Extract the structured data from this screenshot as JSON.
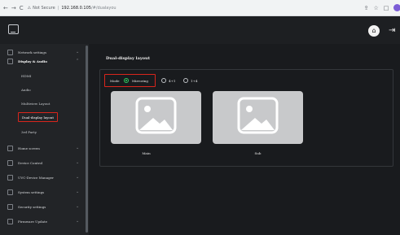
{
  "browser": {
    "back": "←",
    "forward": "→",
    "reload": "C",
    "security_label": "Not Secure",
    "url_host": "192.168.0.105",
    "url_path": "/#/dualayou",
    "share_icon": "⇪",
    "star_icon": "☆",
    "split_icon": "□"
  },
  "header": {
    "home_icon": "⌂",
    "exit_icon": "⇥"
  },
  "sidebar": {
    "items": [
      {
        "label": "Network settings",
        "chevron": "⌄",
        "icon": "wifi-icon"
      },
      {
        "label": "Display & Audio",
        "chevron": "⌃",
        "icon": "display-icon"
      },
      {
        "label": "Home screen",
        "chevron": "⌄",
        "icon": "home-screen-icon"
      },
      {
        "label": "Device Control",
        "chevron": "⌄",
        "icon": "device-control-icon"
      },
      {
        "label": "UVC-Device Manager",
        "chevron": "⌄",
        "icon": "uvc-icon"
      },
      {
        "label": "System settings",
        "chevron": "⌄",
        "icon": "system-icon"
      },
      {
        "label": "Security settings",
        "chevron": "⌄",
        "icon": "shield-icon"
      },
      {
        "label": "Firmware Update",
        "chevron": "⌄",
        "icon": "firmware-icon"
      }
    ],
    "subitems": [
      "HDMI",
      "Audio",
      "Multiview Layout",
      "Dual-display layout",
      "3rd Party"
    ]
  },
  "main": {
    "title": "Dual-display layout",
    "mode_label": "Mode",
    "options": [
      "Mirroring",
      "4+1",
      "1+4"
    ],
    "selected_option": "Mirroring",
    "cards": [
      "Main",
      "Sub"
    ]
  },
  "colors": {
    "highlight_red": "#d9251c",
    "radio_green": "#2fcf62",
    "profile_purple": "#7b5cd6"
  }
}
